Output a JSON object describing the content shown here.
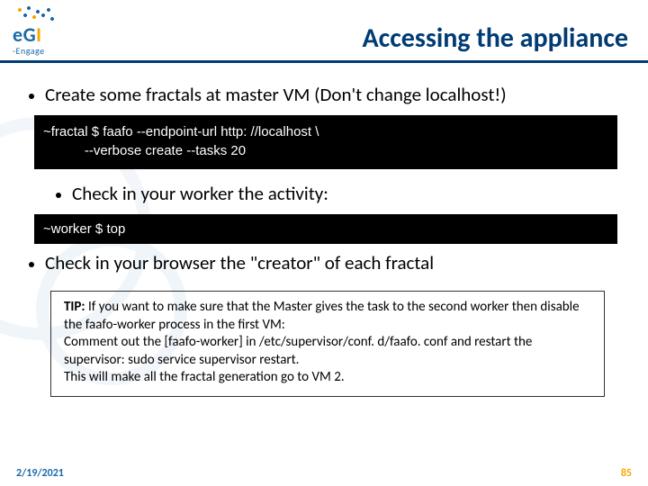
{
  "header": {
    "logo_main": "eGI",
    "logo_sub": "-Engage",
    "title": "Accessing the appliance"
  },
  "bullets": {
    "b1": "Create some fractals at master VM (Don't change localhost!)",
    "b2": "Check in your worker the activity:",
    "b3": "Check in your browser the \"creator\" of each fractal"
  },
  "code": {
    "block1": "~fractal $ faafo --endpoint-url http: //localhost \\\n           --verbose create --tasks 20",
    "block2": "~worker $ top"
  },
  "tip": {
    "lead": "TIP:",
    "body": " If you want to make sure that the Master gives the task to the second worker then disable the faafo-worker process in the first VM:\nComment out the [faafo-worker] in /etc/supervisor/conf. d/faafo. conf and restart the supervisor: sudo service supervisor restart.\nThis will make all the fractal generation go to VM 2."
  },
  "footer": {
    "date": "2/19/2021",
    "page": "85"
  }
}
